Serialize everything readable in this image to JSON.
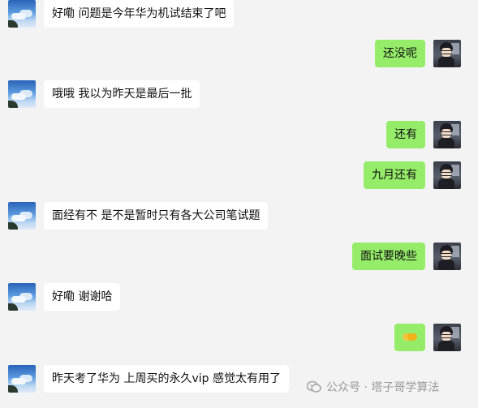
{
  "messages": [
    {
      "side": "left",
      "text": "好嘞 问题是今年华为机试结束了吧",
      "avatar": "sky-avatar"
    },
    {
      "side": "right",
      "text": "还没呢",
      "avatar": "anime-avatar"
    },
    {
      "side": "left",
      "text": "哦哦 我以为昨天是最后一批",
      "avatar": "sky-avatar"
    },
    {
      "side": "right",
      "text": "还有",
      "avatar": "anime-avatar"
    },
    {
      "side": "right",
      "text": "九月还有",
      "avatar": "anime-avatar"
    },
    {
      "side": "left",
      "text": "面经有不 是不是暂时只有各大公司笔试题",
      "avatar": "sky-avatar"
    },
    {
      "side": "right",
      "text": "面试要晚些",
      "avatar": "anime-avatar"
    },
    {
      "side": "left",
      "text": "好嘞 谢谢哈",
      "avatar": "sky-avatar"
    },
    {
      "side": "right",
      "text": "",
      "emoji": "handshake-emoji",
      "avatar": "anime-avatar"
    },
    {
      "side": "left",
      "text": "昨天考了华为 上周买的永久vip 感觉太有用了",
      "avatar": "sky-avatar"
    }
  ],
  "watermark": {
    "text": "公众号 · 塔子哥学算法",
    "icon": "wechat-official-account-icon"
  },
  "colors": {
    "background": "#f3f3f3",
    "incoming_bubble": "#ffffff",
    "outgoing_bubble": "#95ec69",
    "watermark_text": "#9a9a9a"
  }
}
